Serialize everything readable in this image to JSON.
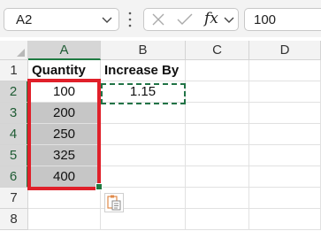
{
  "formula_bar": {
    "name_box": "A2",
    "fx_label": "fx",
    "formula": "100"
  },
  "sheet": {
    "columns": [
      "A",
      "B",
      "C",
      "D"
    ],
    "rows": [
      "1",
      "2",
      "3",
      "4",
      "5",
      "6",
      "7",
      "8"
    ],
    "cells": {
      "A1": "Quantity",
      "B1": "Increase By",
      "A2": "100",
      "B2": "1.15",
      "A3": "200",
      "A4": "250",
      "A5": "325",
      "A6": "400"
    },
    "selected_range": "A2:A6",
    "copied_cell": "B2"
  },
  "colors": {
    "highlight_border": "#e0202a",
    "selection_accent": "#1f7a42",
    "selected_fill": "#c6c6c6"
  }
}
